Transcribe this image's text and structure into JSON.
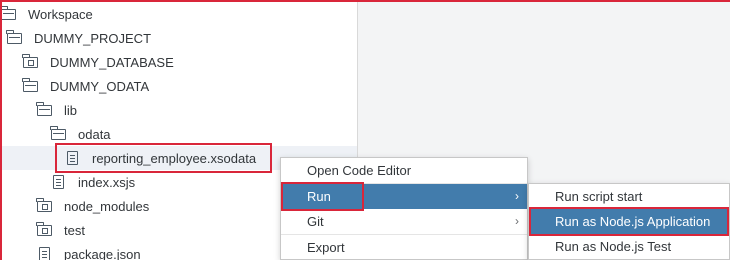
{
  "tree": {
    "items": [
      {
        "label": "Workspace"
      },
      {
        "label": "DUMMY_PROJECT"
      },
      {
        "label": "DUMMY_DATABASE"
      },
      {
        "label": "DUMMY_ODATA"
      },
      {
        "label": "lib"
      },
      {
        "label": "odata"
      },
      {
        "label": "reporting_employee.xsodata"
      },
      {
        "label": "index.xsjs"
      },
      {
        "label": "node_modules"
      },
      {
        "label": "test"
      },
      {
        "label": "package.json"
      }
    ]
  },
  "context_menu": {
    "items": [
      {
        "label": "Open Code Editor"
      },
      {
        "label": "Run",
        "chevron": "›"
      },
      {
        "label": "Git",
        "chevron": "›"
      },
      {
        "label": "Export"
      }
    ]
  },
  "run_submenu": {
    "items": [
      {
        "label": "Run script start"
      },
      {
        "label": "Run as Node.js Application"
      },
      {
        "label": "Run as Node.js Test"
      }
    ]
  },
  "colors": {
    "accent": "#427cac",
    "highlight": "#d9263a"
  }
}
